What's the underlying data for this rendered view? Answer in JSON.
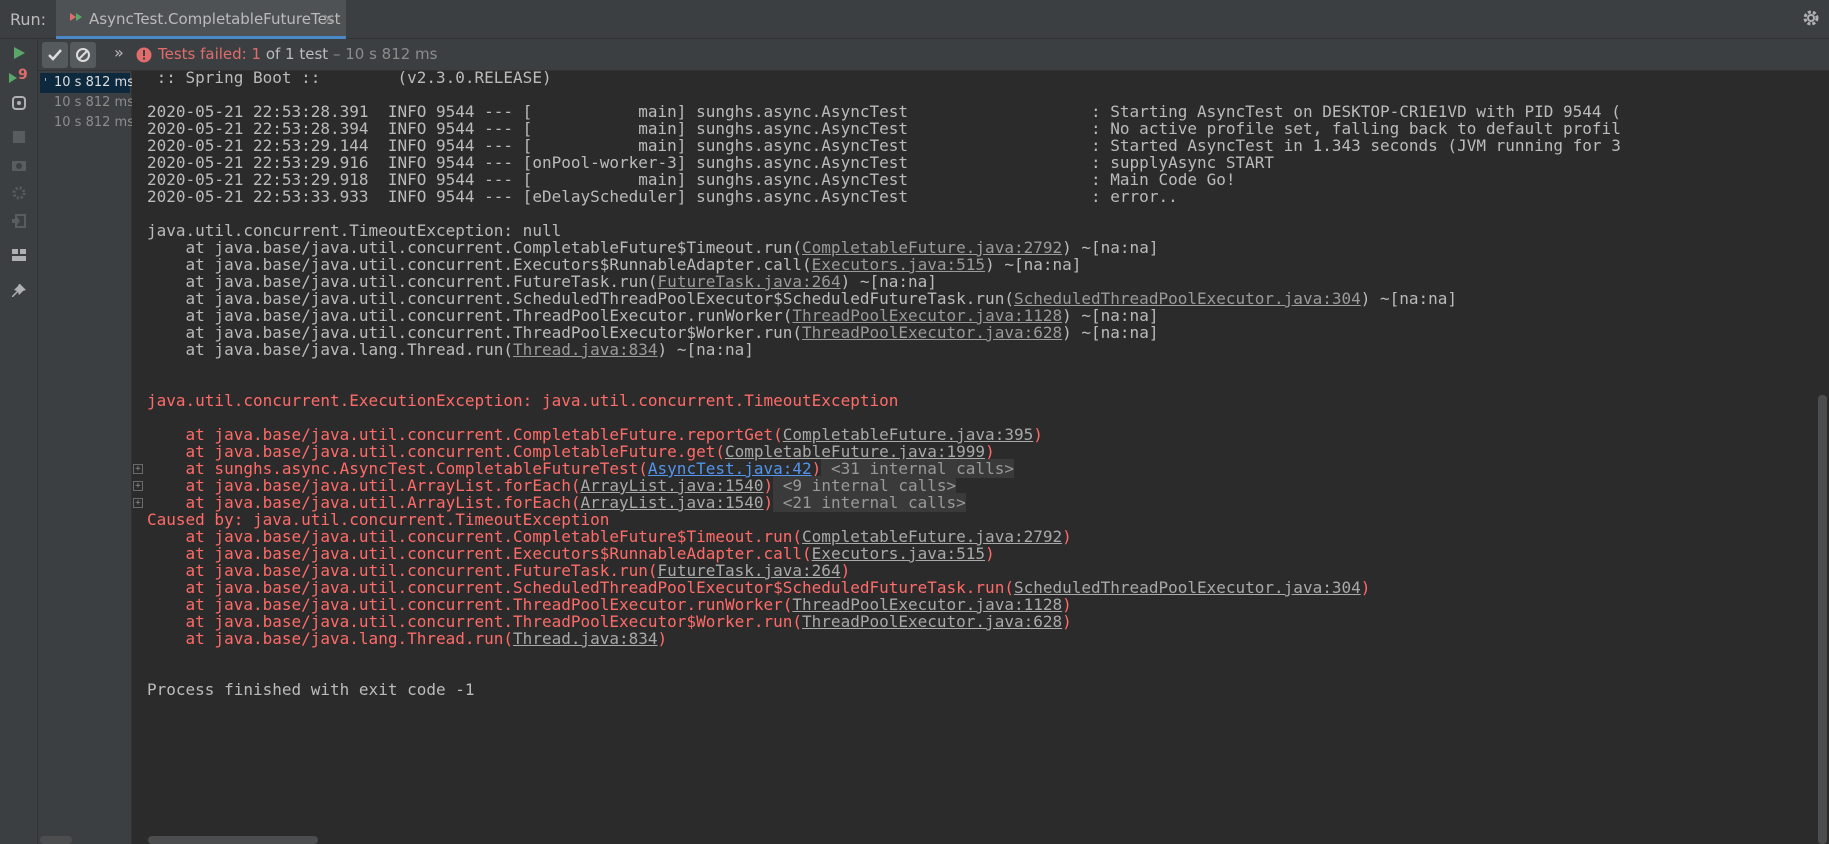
{
  "window": {
    "run_label": "Run:",
    "tab_title": "AsyncTest.CompletableFutureTest",
    "tab_close": "×"
  },
  "toolbar": {
    "more": "»",
    "status_failed": "Tests failed: 1",
    "status_rest": " of 1 test",
    "status_time": " – 10 s 812 ms"
  },
  "tree": {
    "rows": [
      {
        "label": "10 s 812 ms"
      },
      {
        "label": "10 s 812 ms"
      },
      {
        "label": "10 s 812 ms"
      }
    ]
  },
  "badges": {
    "rerun_count": "9"
  },
  "colors": {
    "error": "#ff6b68",
    "link_blue": "#5394ec",
    "accent": "#4a88c7",
    "run_green": "#59a869"
  },
  "console": {
    "l0": " :: Spring Boot ::        (v2.3.0.RELEASE)",
    "l1": "2020-05-21 22:53:28.391  INFO 9544 --- [           main] sunghs.async.AsyncTest                   : Starting AsyncTest on DESKTOP-CR1E1VD with PID 9544 (",
    "l2": "2020-05-21 22:53:28.394  INFO 9544 --- [           main] sunghs.async.AsyncTest                   : No active profile set, falling back to default profil",
    "l3": "2020-05-21 22:53:29.144  INFO 9544 --- [           main] sunghs.async.AsyncTest                   : Started AsyncTest in 1.343 seconds (JVM running for 3",
    "l4": "2020-05-21 22:53:29.916  INFO 9544 --- [onPool-worker-3] sunghs.async.AsyncTest                   : supplyAsync START",
    "l5": "2020-05-21 22:53:29.918  INFO 9544 --- [           main] sunghs.async.AsyncTest                   : Main Code Go!",
    "l6": "2020-05-21 22:53:33.933  INFO 9544 --- [eDelayScheduler] sunghs.async.AsyncTest                   : error..",
    "l7": "java.util.concurrent.TimeoutException: null",
    "t1": {
      "pre": "    at java.base/java.util.concurrent.CompletableFuture$Timeout.run(",
      "link": "CompletableFuture.java:2792",
      "post": ") ~[na:na]"
    },
    "t2": {
      "pre": "    at java.base/java.util.concurrent.Executors$RunnableAdapter.call(",
      "link": "Executors.java:515",
      "post": ") ~[na:na]"
    },
    "t3": {
      "pre": "    at java.base/java.util.concurrent.FutureTask.run(",
      "link": "FutureTask.java:264",
      "post": ") ~[na:na]"
    },
    "t4": {
      "pre": "    at java.base/java.util.concurrent.ScheduledThreadPoolExecutor$ScheduledFutureTask.run(",
      "link": "ScheduledThreadPoolExecutor.java:304",
      "post": ") ~[na:na]"
    },
    "t5": {
      "pre": "    at java.base/java.util.concurrent.ThreadPoolExecutor.runWorker(",
      "link": "ThreadPoolExecutor.java:1128",
      "post": ") ~[na:na]"
    },
    "t6": {
      "pre": "    at java.base/java.util.concurrent.ThreadPoolExecutor$Worker.run(",
      "link": "ThreadPoolExecutor.java:628",
      "post": ") ~[na:na]"
    },
    "t7": {
      "pre": "    at java.base/java.lang.Thread.run(",
      "link": "Thread.java:834",
      "post": ") ~[na:na]"
    },
    "e0": "java.util.concurrent.ExecutionException: java.util.concurrent.TimeoutException",
    "e1": {
      "pre": "    at java.base/java.util.concurrent.CompletableFuture.reportGet(",
      "link": "CompletableFuture.java:395",
      "post": ")"
    },
    "e2": {
      "pre": "    at java.base/java.util.concurrent.CompletableFuture.get(",
      "link": "CompletableFuture.java:1999",
      "post": ")"
    },
    "e3": {
      "pre": "    at sunghs.async.AsyncTest.CompletableFutureTest(",
      "link": "AsyncTest.java:42",
      "post": ")",
      "internal": " <31 internal calls>"
    },
    "e4": {
      "pre": "    at java.base/java.util.ArrayList.forEach(",
      "link": "ArrayList.java:1540",
      "post": ")",
      "internal": " <9 internal calls>"
    },
    "e5": {
      "pre": "    at java.base/java.util.ArrayList.forEach(",
      "link": "ArrayList.java:1540",
      "post": ")",
      "internal": " <21 internal calls>"
    },
    "c0": "Caused by: java.util.concurrent.TimeoutException",
    "c1": {
      "pre": "    at java.base/java.util.concurrent.CompletableFuture$Timeout.run(",
      "link": "CompletableFuture.java:2792",
      "post": ")"
    },
    "c2": {
      "pre": "    at java.base/java.util.concurrent.Executors$RunnableAdapter.call(",
      "link": "Executors.java:515",
      "post": ")"
    },
    "c3": {
      "pre": "    at java.base/java.util.concurrent.FutureTask.run(",
      "link": "FutureTask.java:264",
      "post": ")"
    },
    "c4": {
      "pre": "    at java.base/java.util.concurrent.ScheduledThreadPoolExecutor$ScheduledFutureTask.run(",
      "link": "ScheduledThreadPoolExecutor.java:304",
      "post": ")"
    },
    "c5": {
      "pre": "    at java.base/java.util.concurrent.ThreadPoolExecutor.runWorker(",
      "link": "ThreadPoolExecutor.java:1128",
      "post": ")"
    },
    "c6": {
      "pre": "    at java.base/java.util.concurrent.ThreadPoolExecutor$Worker.run(",
      "link": "ThreadPoolExecutor.java:628",
      "post": ")"
    },
    "c7": {
      "pre": "    at java.base/java.lang.Thread.run(",
      "link": "Thread.java:834",
      "post": ")"
    },
    "fold": "+",
    "exit": "Process finished with exit code -1"
  }
}
